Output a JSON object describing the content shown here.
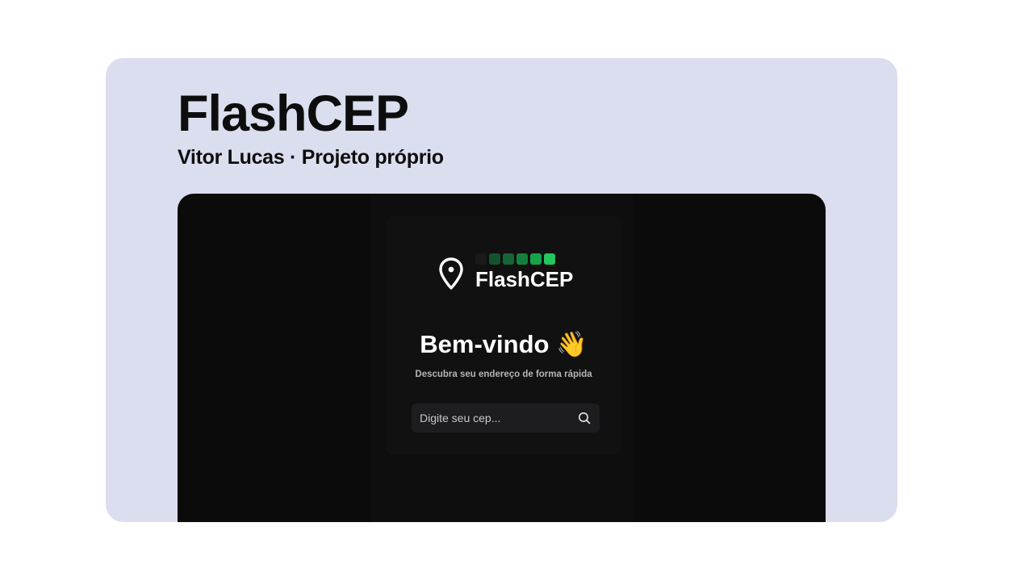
{
  "header": {
    "title": "FlashCEP",
    "subtitle": "Vitor Lucas · Projeto próprio"
  },
  "app": {
    "logo_text": "FlashCEP",
    "logo_icon": "map-pin-icon",
    "logo_bar_colors": [
      "#1a1a1a",
      "#14532d",
      "#166534",
      "#15803d",
      "#16a34a",
      "#22c55e"
    ],
    "welcome": "Bem-vindo",
    "welcome_emoji": "👋",
    "tagline": "Descubra seu endereço de forma rápida",
    "search": {
      "placeholder": "Digite seu cep...",
      "value": "",
      "icon": "search-icon"
    }
  },
  "colors": {
    "card_background": "#dbdeee",
    "preview_background": "#0b0b0b",
    "accent_green": "#22c55e"
  }
}
